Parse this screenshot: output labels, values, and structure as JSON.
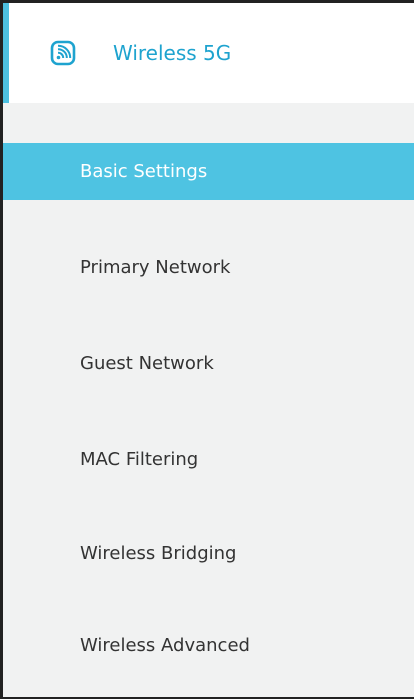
{
  "header": {
    "title": "Wireless 5G",
    "icon": "wireless-signal-icon",
    "accent_color": "#1ea3cf"
  },
  "menu": {
    "active_color": "#4ec3e2",
    "items": [
      {
        "label": "Basic Settings",
        "active": true
      },
      {
        "label": "Primary Network",
        "active": false
      },
      {
        "label": "Guest Network",
        "active": false
      },
      {
        "label": "MAC Filtering",
        "active": false
      },
      {
        "label": "Wireless Bridging",
        "active": false
      },
      {
        "label": "Wireless Advanced",
        "active": false
      }
    ]
  }
}
